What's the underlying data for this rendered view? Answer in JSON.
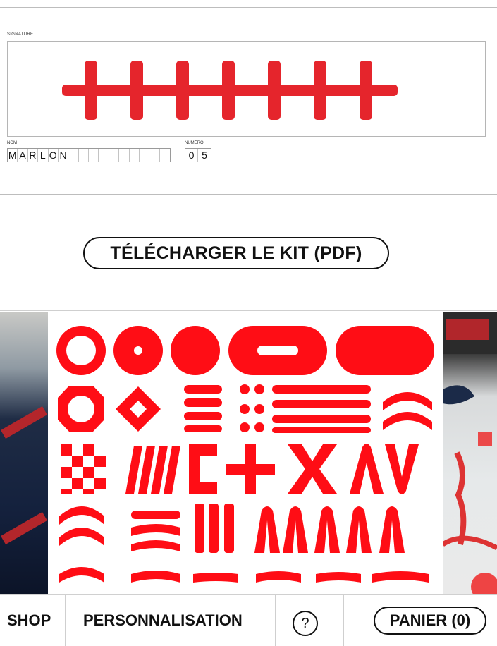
{
  "signature": {
    "label": "SIGNATURE",
    "name_label": "NOM",
    "name_cells": [
      "M",
      "A",
      "R",
      "L",
      "O",
      "N",
      "",
      "",
      "",
      "",
      "",
      "",
      "",
      "",
      "",
      ""
    ],
    "number_label": "NUMÉRO",
    "number_cells": [
      "0",
      "5"
    ]
  },
  "download_button": "TÉLÉCHARGER LE KIT (PDF)",
  "poster": {
    "description_icon": "shape-pattern-icon"
  },
  "nav": {
    "shop": "SHOP",
    "personalisation": "PERSONNALISATION",
    "help": "?",
    "cart": "PANIER (0)"
  },
  "colors": {
    "accent": "#e5252c",
    "poster_red": "#ff0d15",
    "text": "#111111"
  }
}
